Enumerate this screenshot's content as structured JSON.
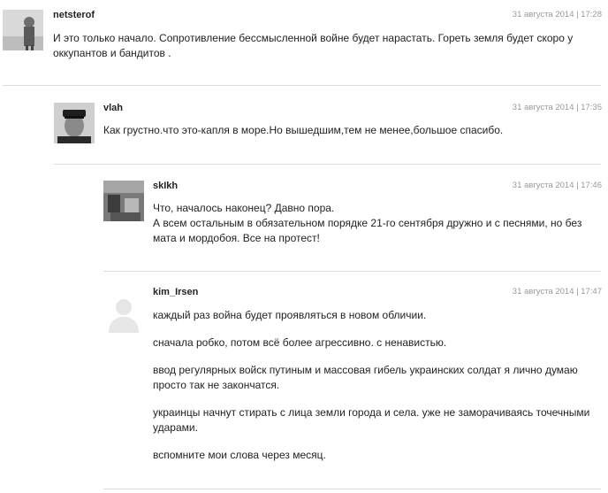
{
  "comments": [
    {
      "author": "netsterof",
      "date": "31 августа 2014 | 17:28",
      "lines": [
        "И это только начало. Сопротивление бессмысленной войне будет нарастать. Гореть земля будет скоро у оккупантов и бандитов ."
      ]
    },
    {
      "author": "vlah",
      "date": "31 августа 2014 | 17:35",
      "lines": [
        "Как грустно.что это-капля в море.Но вышедшим,тем не менее,большое спасибо."
      ]
    },
    {
      "author": "skIkh",
      "date": "31 августа 2014 | 17:46",
      "lines": [
        "Что, началось наконец? Давно пора.",
        "А всем остальным в обязательном порядке 21-го сентября дружно и с песнями, но без мата и мордобоя. Все на протест!"
      ]
    },
    {
      "author": "kim_Irsen",
      "date": "31 августа 2014 | 17:47",
      "lines": [
        "каждый раз война будет проявляться в новом обличии.",
        "сначала робко, потом всё более агрессивно. с ненавистью.",
        "ввод регулярных войск путиным и массовая гибель украинских солдат я лично думаю просто так не закончатся.",
        "украинцы начнут стирать с лица земли города и села. уже не заморачиваясь точечными ударами.",
        "вспомните мои слова через месяц."
      ]
    }
  ],
  "colors": {
    "text": "#222222",
    "date": "#999999",
    "separator": "#dcdcdc"
  }
}
